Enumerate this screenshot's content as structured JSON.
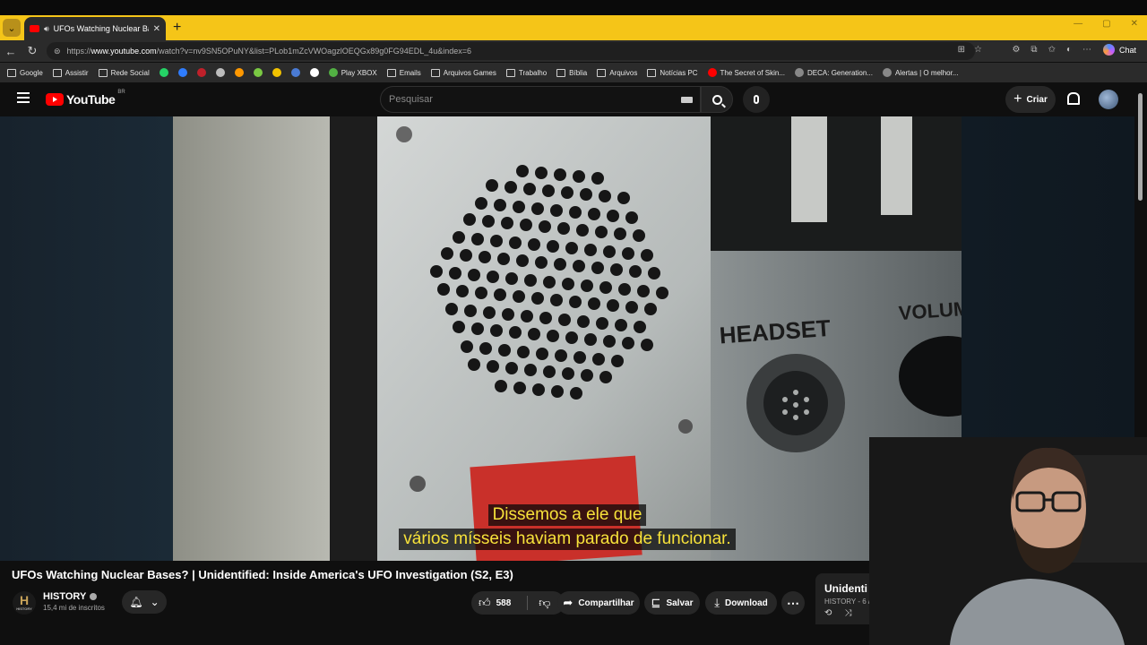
{
  "browser": {
    "tab_title": "UFOs Watching Nuclear Bases",
    "url_prefix": "https://",
    "url_host": "www.youtube.com",
    "url_path": "/watch?v=nv9SN5OPuNY&list=PLob1mZcVWOagzlOEQGx89g0FG94EDL_4u&index=6",
    "chat_label": "Chat"
  },
  "bookmarks": [
    {
      "label": "Google",
      "icon": "folder-icon"
    },
    {
      "label": "Assistir",
      "icon": "folder-icon"
    },
    {
      "label": "Rede Social",
      "icon": "folder-icon"
    },
    {
      "label": "",
      "icon": "whatsapp-icon",
      "color": "#25d366"
    },
    {
      "label": "",
      "icon": "app-icon",
      "color": "#2f7dff"
    },
    {
      "label": "",
      "icon": "app-icon",
      "color": "#c0202a"
    },
    {
      "label": "",
      "icon": "app-icon",
      "color": "#bdbdbd"
    },
    {
      "label": "",
      "icon": "app-icon",
      "color": "#ff9800"
    },
    {
      "label": "",
      "icon": "download-icon",
      "color": "#7ac943"
    },
    {
      "label": "",
      "icon": "app-icon",
      "color": "#f2c200"
    },
    {
      "label": "",
      "icon": "app-icon",
      "color": "#4a7bd4"
    },
    {
      "label": "",
      "icon": "app-icon",
      "color": "#ffffff"
    },
    {
      "label": "Play XBOX",
      "icon": "xbox-icon",
      "color": "#52b043"
    },
    {
      "label": "Emails",
      "icon": "folder-icon"
    },
    {
      "label": "Arquivos Games",
      "icon": "folder-icon"
    },
    {
      "label": "Trabalho",
      "icon": "folder-icon"
    },
    {
      "label": "Bíblia",
      "icon": "folder-icon"
    },
    {
      "label": "Arquivos",
      "icon": "folder-icon"
    },
    {
      "label": "Notícias PC",
      "icon": "folder-icon"
    },
    {
      "label": "The Secret of Skin...",
      "icon": "youtube-icon",
      "color": "#ff0000"
    },
    {
      "label": "DECA: Generation...",
      "icon": "globe-icon"
    },
    {
      "label": "Alertas | O melhor...",
      "icon": "alert-icon"
    }
  ],
  "youtube": {
    "logo_text": "YouTube",
    "region": "BR",
    "search_placeholder": "Pesquisar",
    "create_label": "Criar"
  },
  "video": {
    "panel_text_left": "HEADSET",
    "panel_text_right": "VOLUM",
    "caption_line1": "Dissemos a ele que",
    "caption_line2": "vários mísseis haviam parado de funcionar.",
    "title": "UFOs Watching Nuclear Bases? | Unidentified: Inside America's UFO Investigation (S2, E3)"
  },
  "channel": {
    "logo_letter": "H",
    "logo_small": "HISTORY",
    "name": "HISTORY",
    "subscribers": "15,4 mi de inscritos"
  },
  "actions": {
    "likes": "588",
    "share": "Compartilhar",
    "save": "Salvar",
    "download": "Download"
  },
  "playlist": {
    "title": "Unidenti",
    "meta": "HISTORY - 6 /"
  }
}
